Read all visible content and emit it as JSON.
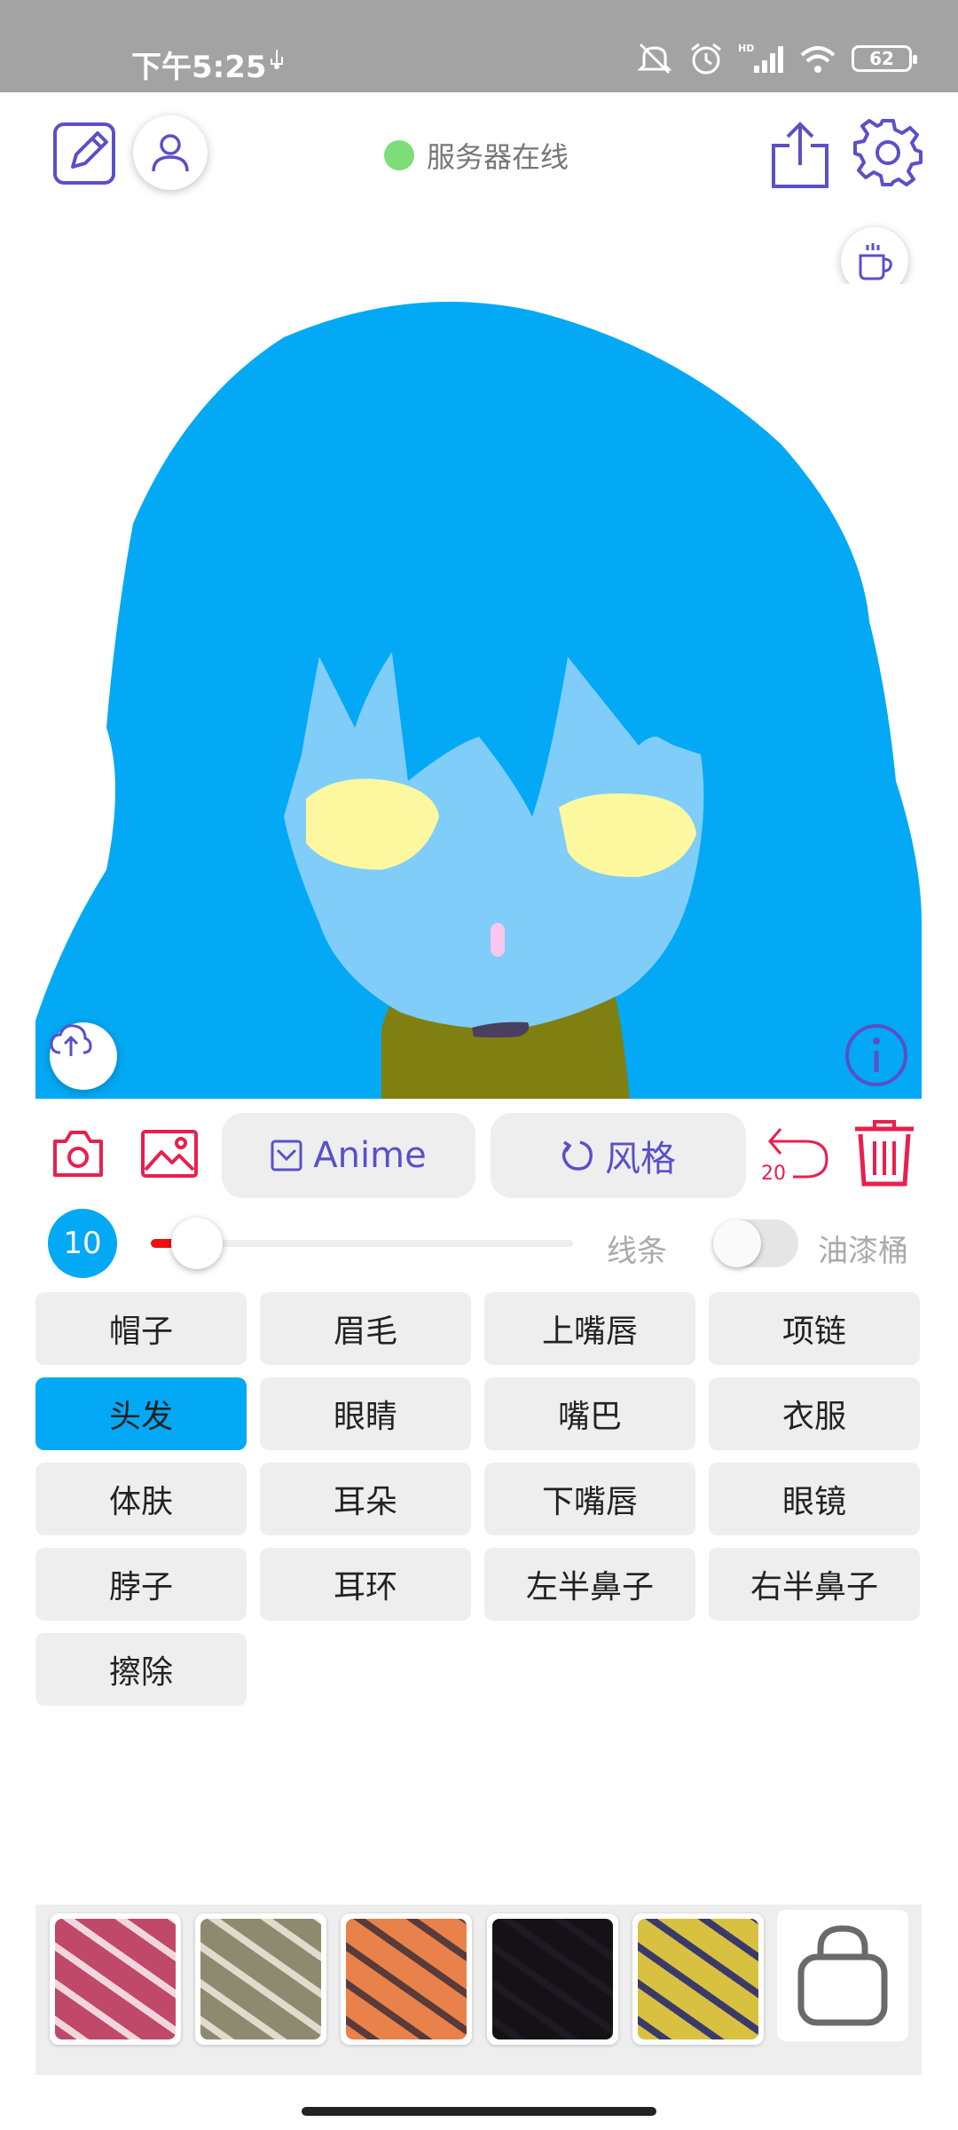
{
  "status_bar": {
    "time": "下午5:25",
    "battery": "62",
    "icons": [
      "usb-icon",
      "mute-icon",
      "alarm-icon",
      "hd-signal-icon",
      "wifi-icon",
      "battery-icon"
    ]
  },
  "toolbar": {
    "edit_icon": "edit-pencil-icon",
    "user_icon": "user-icon",
    "server_status": "服务器在线",
    "server_status_color": "#7cde78",
    "share_icon": "share-icon",
    "settings_icon": "gear-icon",
    "coffee_icon": "coffee-icon"
  },
  "canvas": {
    "upload_icon": "cloud-upload-icon",
    "info_icon": "info-icon",
    "colors": {
      "hair": "#03a9f4",
      "skin": "#7fcdf8",
      "eyes": "#fdf8a0",
      "nose": "#f8c6ee",
      "mouth": "#4a3f5e",
      "clothes": "#7f7f12"
    }
  },
  "actions": {
    "camera_icon": "camera-icon",
    "gallery_icon": "image-icon",
    "anime_label": "Anime",
    "style_label": "风格",
    "undo_count": "20",
    "trash_icon": "trash-icon"
  },
  "brush": {
    "size": "10",
    "size_fraction": 0.11,
    "line_label": "线条",
    "bucket_label": "油漆桶",
    "bucket_enabled": false
  },
  "parts": [
    {
      "label": "帽子",
      "active": false
    },
    {
      "label": "眉毛",
      "active": false
    },
    {
      "label": "上嘴唇",
      "active": false
    },
    {
      "label": "项链",
      "active": false
    },
    {
      "label": "头发",
      "active": true
    },
    {
      "label": "眼睛",
      "active": false
    },
    {
      "label": "嘴巴",
      "active": false
    },
    {
      "label": "衣服",
      "active": false
    },
    {
      "label": "体肤",
      "active": false
    },
    {
      "label": "耳朵",
      "active": false
    },
    {
      "label": "下嘴唇",
      "active": false
    },
    {
      "label": "眼镜",
      "active": false
    },
    {
      "label": "脖子",
      "active": false
    },
    {
      "label": "耳环",
      "active": false
    },
    {
      "label": "左半鼻子",
      "active": false
    },
    {
      "label": "右半鼻子",
      "active": false
    },
    {
      "label": "擦除",
      "active": false
    }
  ],
  "textures": [
    {
      "name": "texture-pink-red",
      "color": "#c04868",
      "accent": "#f2d6de"
    },
    {
      "name": "texture-gray-olive",
      "color": "#8e8a70",
      "accent": "#dfdccd"
    },
    {
      "name": "texture-orange",
      "color": "#e8824a",
      "accent": "#5a3a3a"
    },
    {
      "name": "texture-black",
      "color": "#141216",
      "accent": "#1e1a22"
    },
    {
      "name": "texture-yellow-navy",
      "color": "#d8c040",
      "accent": "#3a3a6a"
    }
  ],
  "shop_icon": "shopping-bag-icon"
}
